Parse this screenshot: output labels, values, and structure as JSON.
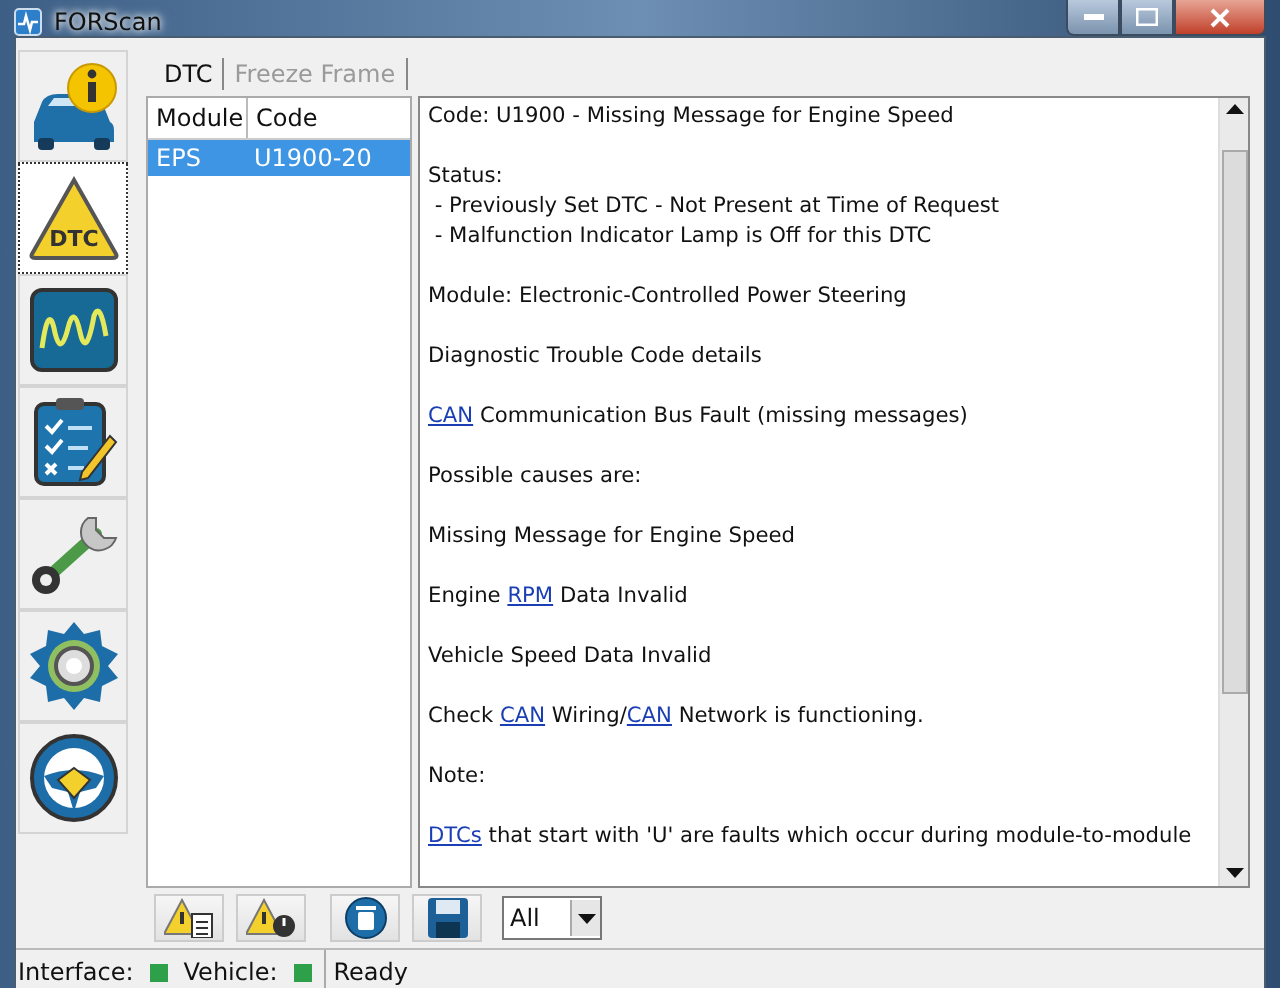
{
  "window": {
    "title": "FORScan"
  },
  "sidebar": {
    "items": [
      {
        "selected": false
      },
      {
        "selected": true,
        "icon_text": "DTC"
      },
      {
        "selected": false
      },
      {
        "selected": false
      },
      {
        "selected": false
      },
      {
        "selected": false
      },
      {
        "selected": false
      }
    ]
  },
  "tabs": [
    {
      "label": "DTC",
      "selected": true
    },
    {
      "label": "Freeze Frame",
      "selected": false
    }
  ],
  "table": {
    "columns": [
      "Module",
      "Code"
    ],
    "rows": [
      {
        "cells": [
          "EPS",
          "U1900-20"
        ],
        "selected": true
      }
    ]
  },
  "details": {
    "paragraphs": [
      [
        [
          {
            "kind": "text",
            "text": "Code: U1900 - Missing Message for Engine Speed"
          }
        ]
      ],
      [
        [
          {
            "kind": "text",
            "text": "Status:"
          }
        ],
        [
          {
            "kind": "text",
            "text": " - Previously Set DTC - Not Present at Time of Request"
          }
        ],
        [
          {
            "kind": "text",
            "text": " - Malfunction Indicator Lamp is Off for this DTC"
          }
        ]
      ],
      [
        [
          {
            "kind": "text",
            "text": "Module: Electronic-Controlled Power Steering"
          }
        ]
      ],
      [
        [
          {
            "kind": "text",
            "text": "Diagnostic Trouble Code details"
          }
        ]
      ],
      [
        [
          {
            "kind": "link",
            "text": "CAN"
          },
          {
            "kind": "text",
            "text": " Communication Bus Fault (missing messages)"
          }
        ]
      ],
      [
        [
          {
            "kind": "text",
            "text": "Possible causes are:"
          }
        ]
      ],
      [
        [
          {
            "kind": "text",
            "text": "Missing Message for Engine Speed"
          }
        ]
      ],
      [
        [
          {
            "kind": "text",
            "text": "Engine "
          },
          {
            "kind": "link",
            "text": "RPM"
          },
          {
            "kind": "text",
            "text": " Data Invalid"
          }
        ]
      ],
      [
        [
          {
            "kind": "text",
            "text": "Vehicle Speed Data Invalid"
          }
        ]
      ],
      [
        [
          {
            "kind": "text",
            "text": "Check "
          },
          {
            "kind": "link",
            "text": "CAN"
          },
          {
            "kind": "text",
            "text": " Wiring/"
          },
          {
            "kind": "link",
            "text": "CAN"
          },
          {
            "kind": "text",
            "text": " Network is functioning."
          }
        ]
      ],
      [
        [
          {
            "kind": "text",
            "text": "Note:"
          }
        ]
      ],
      [
        [
          {
            "kind": "link",
            "text": "DTCs"
          },
          {
            "kind": "text",
            "text": " that start with 'U' are faults which occur during module-to-module"
          }
        ]
      ]
    ]
  },
  "toolbar": {
    "filter": {
      "value": "All"
    }
  },
  "status_bar": {
    "interface_label": "Interface:",
    "interface_ok": true,
    "vehicle_label": "Vehicle:",
    "vehicle_ok": true,
    "message": "Ready"
  }
}
